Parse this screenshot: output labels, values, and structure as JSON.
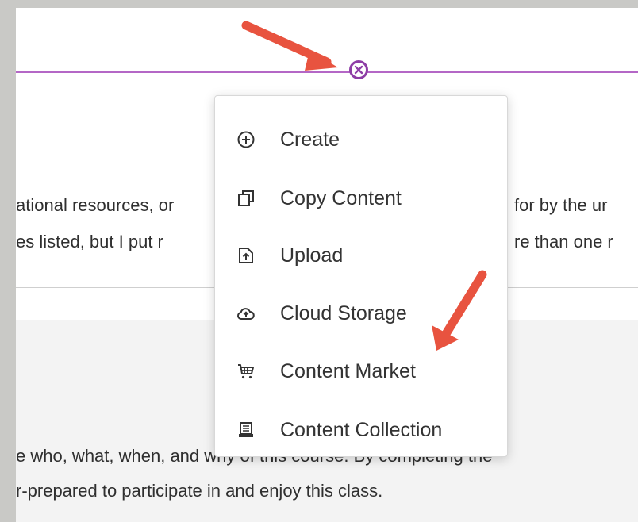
{
  "page": {
    "paragraph1": {
      "line1_left": "ational resources, or",
      "line1_right": "for by the ur",
      "line2_left": "es listed, but I put r",
      "line2_right": "re than one r"
    },
    "paragraph2": {
      "line1": "e who, what, when, and why of this course. By completing the",
      "line2": "r-prepared to participate in and enjoy this class."
    }
  },
  "menu": {
    "items": [
      {
        "label": "Create",
        "icon": "plus-circle-icon"
      },
      {
        "label": "Copy Content",
        "icon": "copy-icon"
      },
      {
        "label": "Upload",
        "icon": "upload-icon"
      },
      {
        "label": "Cloud Storage",
        "icon": "cloud-upload-icon"
      },
      {
        "label": "Content Market",
        "icon": "cart-icon"
      },
      {
        "label": "Content Collection",
        "icon": "collection-icon"
      }
    ]
  },
  "colors": {
    "divider": "#b467c6",
    "close_button": "#8e3ea6",
    "arrow": "#e8533f"
  }
}
